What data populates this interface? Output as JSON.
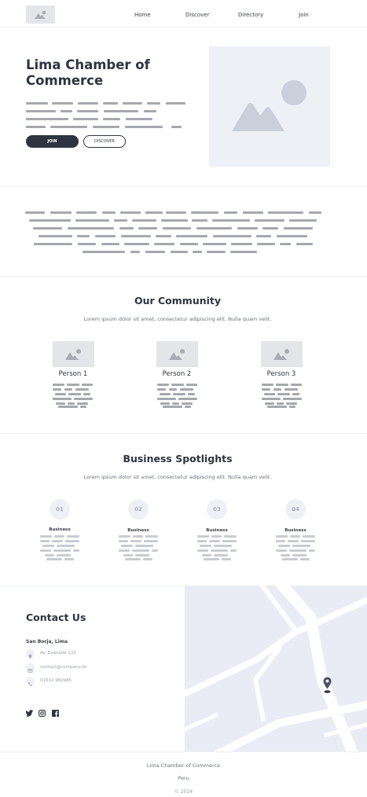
{
  "nav": {
    "logo_icon": "image-placeholder-icon",
    "links": [
      "Home",
      "Discover",
      "Directory",
      "Join"
    ]
  },
  "hero": {
    "title": "Lima Chamber of Commerce",
    "join_label": "JOIN",
    "discover_label": "DISCOVER",
    "image_icon": "image-placeholder-icon"
  },
  "community": {
    "title": "Our Community",
    "subtitle": "Lorem ipsum dolor sit amet, consectetur adipiscing elit. Nulla quam velit.",
    "people": [
      "Person 1",
      "Person 2",
      "Person 3"
    ]
  },
  "spotlights": {
    "title": "Business Spotlights",
    "subtitle": "Lorem ipsum dolor sit amet, consectetur adipiscing elit. Nulla quam velit.",
    "items": [
      {
        "number": "01",
        "label": "Business"
      },
      {
        "number": "02",
        "label": "Business"
      },
      {
        "number": "03",
        "label": "Business"
      },
      {
        "number": "04",
        "label": "Business"
      }
    ]
  },
  "contact": {
    "title": "Contact Us",
    "location": "San Borja, Lima",
    "address": "Av. Example 123",
    "email": "contact@company.de",
    "phone": "01632 960985",
    "social_icons": [
      "twitter-icon",
      "instagram-icon",
      "facebook-icon"
    ]
  },
  "footer": {
    "name": "Lima Chamber of Commerce",
    "country": "Peru",
    "year": "© 2024"
  },
  "colors": {
    "dark": "#2e3440",
    "placeholder": "#edf0f5",
    "map_bg": "#e9ecf4"
  }
}
